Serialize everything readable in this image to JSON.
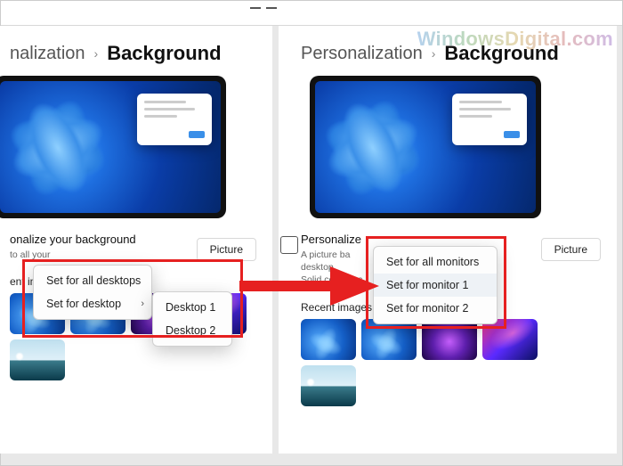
{
  "watermark": "WindowsDigital.com",
  "breadcrumb": {
    "parent": "Personalization",
    "parent_truncated_left": "nalization",
    "chevron": "›",
    "current": "Background"
  },
  "section": {
    "title_full": "Personalize your background",
    "title_truncated_left": "onalize your background",
    "title_truncated_right": "Personalize",
    "desc_left_fragment": "to all your",
    "desc_right_line1": "A picture ba",
    "desc_right_line2_a": "ent desktop.",
    "desc_right_line2_b": "Solid color or s",
    "desc_right_line2_c": "y to all your",
    "picture_button": "Picture"
  },
  "recent": {
    "label": "Recent images",
    "label_truncated_left": "ent ima"
  },
  "menu_left": {
    "items": [
      {
        "label": "Set for all desktops"
      },
      {
        "label": "Set for desktop",
        "has_submenu": true
      }
    ],
    "submenu": [
      {
        "label": "Desktop 1"
      },
      {
        "label": "Desktop 2"
      }
    ]
  },
  "menu_right": {
    "items": [
      {
        "label": "Set for all monitors"
      },
      {
        "label": "Set for monitor 1",
        "hover": true
      },
      {
        "label": "Set for monitor 2"
      }
    ]
  }
}
